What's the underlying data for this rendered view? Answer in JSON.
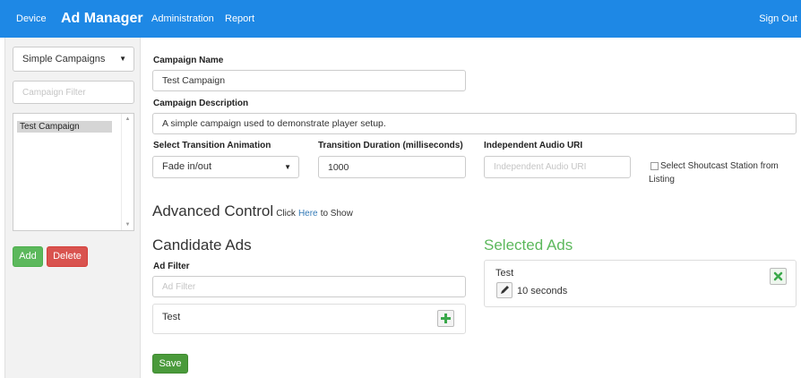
{
  "navbar": {
    "device": "Device",
    "brand": "Ad Manager",
    "administration": "Administration",
    "report": "Report",
    "sign_out": "Sign Out"
  },
  "sidebar": {
    "campaign_type": "Simple Campaigns",
    "filter_placeholder": "Campaign Filter",
    "campaigns": [
      "Test Campaign"
    ],
    "add_label": "Add",
    "delete_label": "Delete"
  },
  "form": {
    "name_label": "Campaign Name",
    "name_value": "Test Campaign",
    "description_label": "Campaign Description",
    "description_value": "A simple campaign used to demonstrate player setup.",
    "transition_label": "Select Transition Animation",
    "transition_value": "Fade in/out",
    "duration_label": "Transition Duration (milliseconds)",
    "duration_value": "1000",
    "audio_label": "Independent Audio URI",
    "audio_placeholder": "Independent Audio URI",
    "shoutcast_label": "Select Shoutcast Station from Listing",
    "advanced_title": "Advanced Control",
    "advanced_click": "Click",
    "advanced_here": "Here",
    "advanced_to_show": "to Show"
  },
  "candidate_ads": {
    "title": "Candidate Ads",
    "filter_label": "Ad Filter",
    "filter_placeholder": "Ad Filter",
    "items": [
      {
        "name": "Test"
      }
    ]
  },
  "selected_ads": {
    "title": "Selected Ads",
    "items": [
      {
        "name": "Test",
        "duration": "10 seconds"
      }
    ]
  },
  "save_label": "Save",
  "colors": {
    "navbar": "#1e88e5",
    "accent_green": "#5cb85c",
    "danger_red": "#d9534f",
    "link_blue": "#337ab7"
  }
}
